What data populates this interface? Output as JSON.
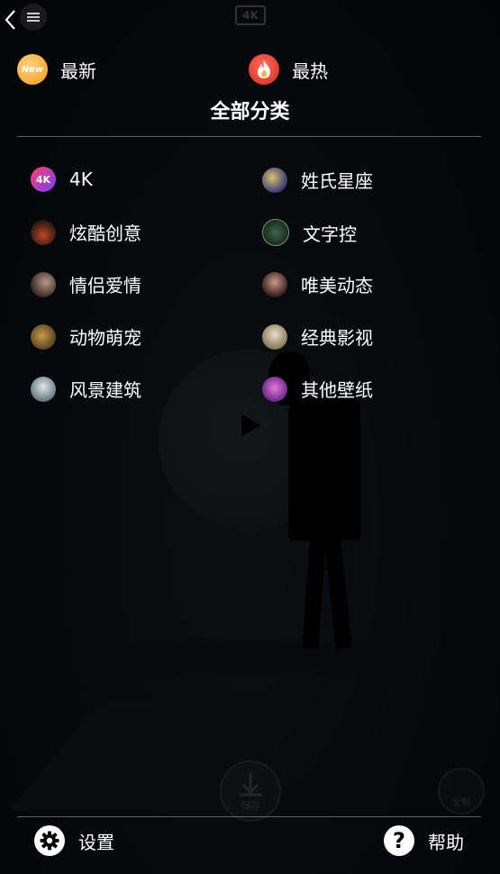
{
  "top_bar": {
    "badge": "4K"
  },
  "quick_links": [
    {
      "label": "最新",
      "icon": "new-icon",
      "icon_text": "New"
    },
    {
      "label": "最热",
      "icon": "fire-icon"
    }
  ],
  "section_title": "全部分类",
  "categories": [
    {
      "label": "4K",
      "thumb_text": "4K"
    },
    {
      "label": "姓氏星座"
    },
    {
      "label": "炫酷创意"
    },
    {
      "label": "文字控"
    },
    {
      "label": "情侣爱情"
    },
    {
      "label": "唯美动态"
    },
    {
      "label": "动物萌宠"
    },
    {
      "label": "经典影视"
    },
    {
      "label": "风景建筑"
    },
    {
      "label": "其他壁纸"
    }
  ],
  "background": {
    "save_label": "保存",
    "custom_label": "定制"
  },
  "bottom": {
    "settings_label": "设置",
    "help_label": "帮助"
  },
  "colors": {
    "new_icon": "#f29a19",
    "hot_icon": "#d6261b",
    "text": "#ffffff",
    "background": "#06090c"
  }
}
